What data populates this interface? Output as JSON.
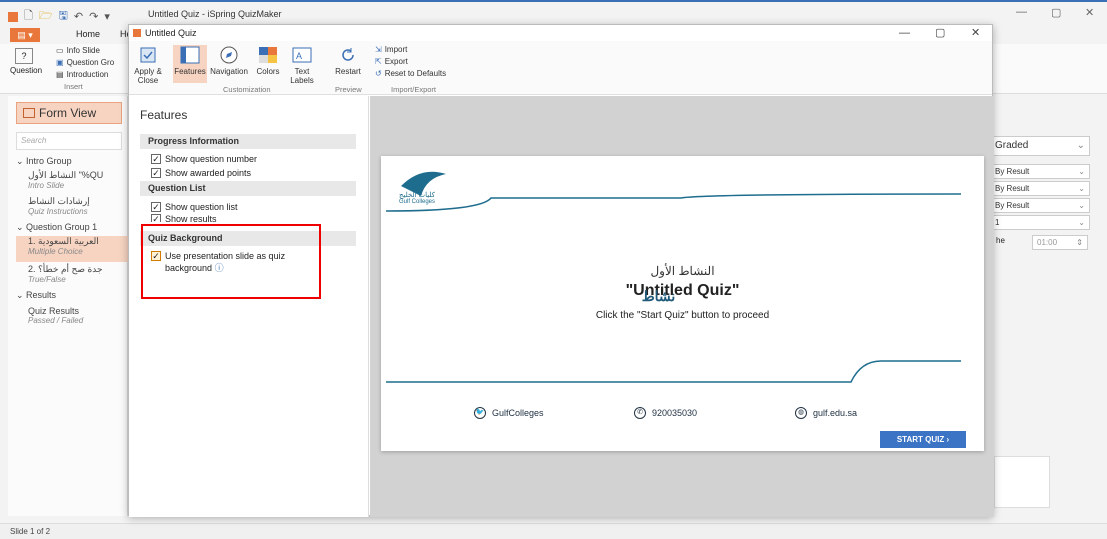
{
  "app": {
    "title": "Untitled Quiz - iSpring QuizMaker",
    "tabs": [
      "Home",
      "He"
    ],
    "ribbon": {
      "question_label": "Question",
      "info_slide": "Info Slide",
      "question_group": "Question Gro",
      "introduction": "Introduction",
      "insert_group": "Insert"
    },
    "form_view": "Form View",
    "search_placeholder": "Search",
    "tree": [
      {
        "label": "Intro Group",
        "type": "group"
      },
      {
        "label": "النشاط الأول \"%QU",
        "sub": "Intro Slide"
      },
      {
        "label": "إرشادات النشاط",
        "sub": "Quiz Instructions"
      },
      {
        "label": "Question Group 1",
        "type": "group"
      },
      {
        "label": "1. العربية السعودية",
        "sub": "Multiple Choice",
        "selected": true
      },
      {
        "label": "2. جدة صح أم خطأ؟",
        "sub": "True/False"
      },
      {
        "label": "Results",
        "type": "group"
      },
      {
        "label": "Quiz Results",
        "sub": "Passed / Failed"
      }
    ],
    "right_panel": {
      "graded": "Graded",
      "by_result_1": "By Result",
      "by_result_2": "By Result",
      "by_result_3": "By Result",
      "value_1": "1",
      "time_label": "he",
      "time_value": "01:00"
    },
    "status": "Slide 1 of 2"
  },
  "dialog": {
    "title": "Untitled Quiz",
    "ribbon": {
      "apply_close": "Apply & Close",
      "features": "Features",
      "navigation": "Navigation",
      "colors": "Colors",
      "text_labels": "Text Labels",
      "restart": "Restart",
      "import": "Import",
      "export": "Export",
      "reset": "Reset to Defaults",
      "group_customization": "Customization",
      "group_preview": "Preview",
      "group_import_export": "Import/Export"
    },
    "features_title": "Features",
    "sections": {
      "progress": "Progress Information",
      "question_list": "Question List",
      "quiz_background": "Quiz Background"
    },
    "options": {
      "show_question_number": "Show question number",
      "show_awarded_points": "Show awarded points",
      "show_question_list": "Show question list",
      "show_results": "Show results",
      "use_presentation": "Use presentation slide as quiz background"
    },
    "slide": {
      "logo_text": "كليات الخليج",
      "logo_sub": "Gulf Colleges",
      "arabic_title": "النشاط الأول",
      "quiz_title": "\"Untitled Quiz\"",
      "overlay_word": "نشاط",
      "instruction": "Click the \"Start Quiz\" button to proceed",
      "twitter": "GulfColleges",
      "phone": "920035030",
      "web": "gulf.edu.sa",
      "start_button": "START QUIZ  ›"
    }
  }
}
